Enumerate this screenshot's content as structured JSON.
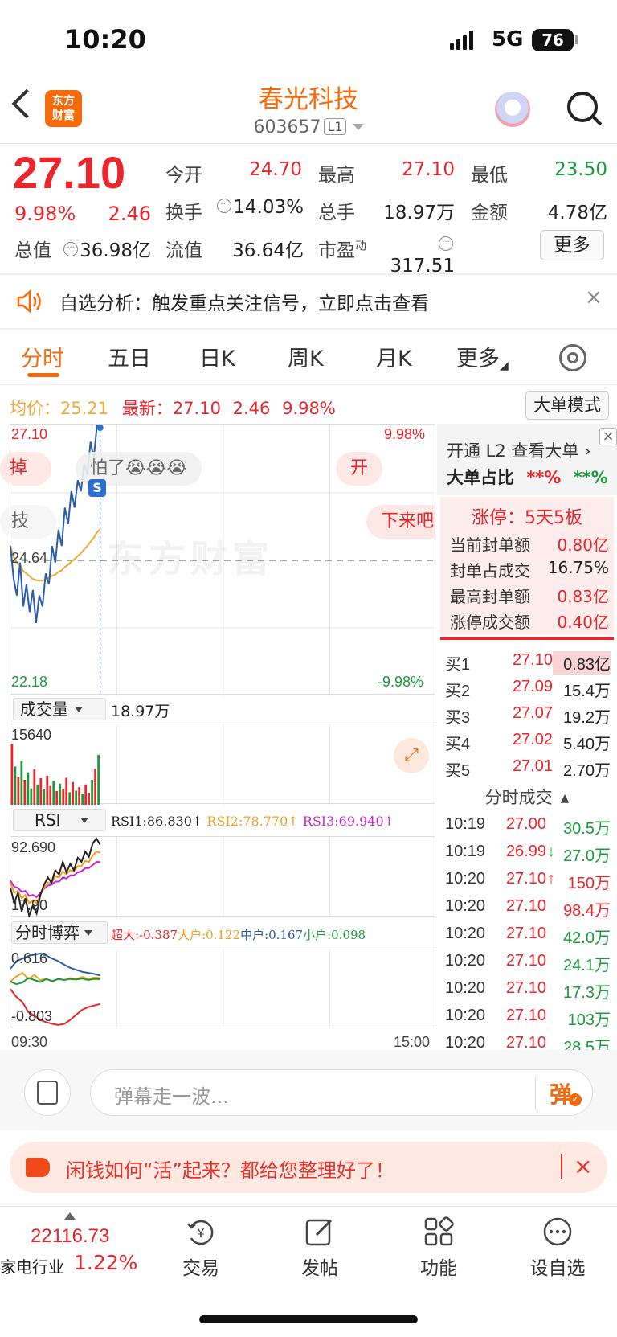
{
  "status": {
    "time": "10:20",
    "network": "5G",
    "battery": "76"
  },
  "header": {
    "logo_text": "东方\n财富",
    "stock_name": "春光科技",
    "stock_code": "603657",
    "level": "L1"
  },
  "quote": {
    "price": "27.10",
    "change_pct": "9.98%",
    "change": "2.46",
    "open_label": "今开",
    "open": "24.70",
    "high_label": "最高",
    "high": "27.10",
    "low_label": "最低",
    "low": "23.50",
    "turnover_label": "换手",
    "turnover": "14.03%",
    "volume_label": "总手",
    "volume": "18.97万",
    "amount_label": "金额",
    "amount": "4.78亿",
    "mktcap_label": "总值",
    "mktcap": "36.98亿",
    "float_label": "流值",
    "float": "36.64亿",
    "pe_label": "市盈",
    "pe_sup": "动",
    "pe": "317.51",
    "more_label": "更多"
  },
  "banner": {
    "text": "自选分析：触发重点关注信号，立即点击查看",
    "close": "×"
  },
  "tabs": [
    "分时",
    "五日",
    "日K",
    "周K",
    "月K",
    "更多"
  ],
  "chart_header": {
    "avg_label": "均价：",
    "avg": "25.21",
    "latest_label": "最新：",
    "latest": "27.10",
    "change": "2.46",
    "pct": "9.98%",
    "big_order_mode": "大单模式"
  },
  "chart_data": [
    {
      "type": "line",
      "name": "分时",
      "ylim": [
        22.18,
        27.1
      ],
      "prev_close": "24.64",
      "y_labels": {
        "top": "27.10",
        "mid": "24.64",
        "bottom": "22.18",
        "top_pct": "9.98%",
        "bottom_pct": "-9.98%"
      },
      "x_labels": [
        "09:30",
        "15:00"
      ],
      "series": [
        {
          "name": "price",
          "color": "#2a5caa",
          "values": [
            24.9,
            24.3,
            24.0,
            24.6,
            23.8,
            24.2,
            23.7,
            24.1,
            23.5,
            24.0,
            23.8,
            24.4,
            24.2,
            24.9,
            24.6,
            25.2,
            24.9,
            25.6,
            25.3,
            25.9,
            25.6,
            26.1,
            25.9,
            26.4,
            26.2,
            26.8,
            26.5,
            27.1,
            27.1
          ]
        },
        {
          "name": "avg",
          "color": "#f2a93b",
          "values": [
            24.9,
            24.7,
            24.6,
            24.55,
            24.45,
            24.4,
            24.35,
            24.3,
            24.28,
            24.27,
            24.27,
            24.3,
            24.32,
            24.36,
            24.38,
            24.43,
            24.46,
            24.52,
            24.56,
            24.62,
            24.66,
            24.72,
            24.77,
            24.84,
            24.9,
            24.98,
            25.05,
            25.15,
            25.21
          ]
        }
      ]
    },
    {
      "type": "bar",
      "name": "成交量",
      "total": "18.97万",
      "max_label": "15640",
      "values": [
        15640,
        9800,
        7200,
        11200,
        6400,
        8300,
        4200,
        9100,
        5200,
        6800,
        3900,
        7400,
        4800,
        6100,
        3500,
        5400,
        4100,
        6900,
        3200,
        5800,
        3600,
        4500,
        2800,
        5200,
        3100,
        6400,
        9200,
        12800
      ],
      "colors": [
        "r",
        "g",
        "r",
        "g",
        "r",
        "g",
        "g",
        "r",
        "g",
        "r",
        "g",
        "r",
        "r",
        "g",
        "r",
        "g",
        "r",
        "r",
        "g",
        "r",
        "g",
        "r",
        "g",
        "r",
        "r",
        "g",
        "r",
        "g"
      ]
    },
    {
      "type": "line",
      "name": "RSI",
      "ylim": [
        17.9,
        92.69
      ],
      "y_labels": {
        "top": "92.690",
        "bottom": "17.90"
      },
      "legend": [
        {
          "label": "RSI1:86.830↑",
          "color": "#222222"
        },
        {
          "label": "RSI2:78.770↑",
          "color": "#f0a020"
        },
        {
          "label": "RSI3:69.940↑",
          "color": "#d020d0"
        }
      ],
      "series": [
        {
          "name": "RSI1",
          "color": "#222222",
          "values": [
            45,
            30,
            40,
            22,
            35,
            18,
            28,
            20,
            38,
            48,
            55,
            50,
            62,
            58,
            70,
            60,
            68,
            62,
            74,
            70,
            80,
            75,
            88,
            92.6,
            86.8
          ]
        },
        {
          "name": "RSI2",
          "color": "#f0a020",
          "values": [
            50,
            40,
            42,
            35,
            38,
            30,
            33,
            30,
            38,
            45,
            50,
            50,
            56,
            55,
            61,
            58,
            62,
            61,
            66,
            66,
            71,
            70,
            76,
            80,
            78.8
          ]
        },
        {
          "name": "RSI3",
          "color": "#d020d0",
          "values": [
            52,
            46,
            45,
            41,
            42,
            37,
            38,
            36,
            40,
            44,
            47,
            48,
            51,
            51,
            55,
            54,
            57,
            57,
            60,
            61,
            64,
            64,
            67,
            70,
            69.9
          ]
        }
      ]
    },
    {
      "type": "line",
      "name": "分时博弈",
      "ylim": [
        -0.803,
        0.616
      ],
      "y_labels": {
        "top": "0.616",
        "bottom": "-0.803"
      },
      "legend": [
        {
          "label": "超大:-0.387",
          "color": "#e8262b"
        },
        {
          "label": "大户:0.122",
          "color": "#f0a020"
        },
        {
          "label": "中户:0.167",
          "color": "#2a5caa"
        },
        {
          "label": "小户:0.098",
          "color": "#1a9c3a"
        }
      ],
      "series": [
        {
          "name": "超大",
          "color": "#e8262b",
          "values": [
            -0.1,
            -0.25,
            -0.35,
            -0.55,
            -0.62,
            -0.7,
            -0.75,
            -0.78,
            -0.8,
            -0.78,
            -0.7,
            -0.6,
            -0.5,
            -0.45,
            -0.42,
            -0.39
          ]
        },
        {
          "name": "大户",
          "color": "#f0a020",
          "values": [
            0.05,
            0.15,
            0.22,
            0.1,
            0.18,
            0.08,
            0.1,
            0.05,
            0.1,
            0.08,
            0.12,
            0.1,
            0.14,
            0.1,
            0.13,
            0.12
          ]
        },
        {
          "name": "中户",
          "color": "#2a5caa",
          "values": [
            0.3,
            0.45,
            0.5,
            0.55,
            0.58,
            0.6,
            0.56,
            0.5,
            0.45,
            0.38,
            0.32,
            0.28,
            0.24,
            0.22,
            0.2,
            0.17
          ]
        },
        {
          "name": "小户",
          "color": "#1a9c3a",
          "values": [
            0.05,
            0.0,
            0.03,
            0.12,
            0.08,
            0.04,
            0.1,
            0.06,
            0.1,
            0.08,
            0.1,
            0.09,
            0.11,
            0.08,
            0.1,
            0.098
          ]
        }
      ]
    }
  ],
  "sub_selectors": {
    "volume": "成交量",
    "rsi": "RSI",
    "game": "分时博弈"
  },
  "danmaku": [
    "掉",
    "怕了😭😭😭",
    "开",
    "技",
    "下来吧"
  ],
  "watermark": "东方财富",
  "right_panel": {
    "open_l2": "开通 L2 查看大单 ›",
    "ratio_label": "大单占比",
    "ratio_red": "**%",
    "ratio_green": "**%",
    "limit_title": "涨停：5天5板",
    "limit_rows": [
      {
        "label": "当前封单额",
        "value": "0.80亿"
      },
      {
        "label": "封单占成交",
        "value": "16.75%"
      },
      {
        "label": "最高封单额",
        "value": "0.83亿"
      },
      {
        "label": "涨停成交额",
        "value": "0.40亿"
      }
    ],
    "order_book": [
      {
        "label": "买1",
        "price": "27.10",
        "vol": "0.83亿"
      },
      {
        "label": "买2",
        "price": "27.09",
        "vol": "15.4万"
      },
      {
        "label": "买3",
        "price": "27.07",
        "vol": "19.2万"
      },
      {
        "label": "买4",
        "price": "27.02",
        "vol": "5.40万"
      },
      {
        "label": "买5",
        "price": "27.01",
        "vol": "2.70万"
      }
    ],
    "ticks_title": "分时成交",
    "ticks": [
      {
        "time": "10:19",
        "price": "27.00",
        "arrow": "",
        "vol": "30.5万",
        "color": "green"
      },
      {
        "time": "10:19",
        "price": "26.99",
        "arrow": "↓",
        "vol": "27.0万",
        "color": "green"
      },
      {
        "time": "10:20",
        "price": "27.10",
        "arrow": "↑",
        "vol": "150万",
        "color": "red"
      },
      {
        "time": "10:20",
        "price": "27.10",
        "arrow": "",
        "vol": "98.4万",
        "color": "red"
      },
      {
        "time": "10:20",
        "price": "27.10",
        "arrow": "",
        "vol": "42.0万",
        "color": "green"
      },
      {
        "time": "10:20",
        "price": "27.10",
        "arrow": "",
        "vol": "24.1万",
        "color": "green"
      },
      {
        "time": "10:20",
        "price": "27.10",
        "arrow": "",
        "vol": "17.3万",
        "color": "green"
      },
      {
        "time": "10:20",
        "price": "27.10",
        "arrow": "",
        "vol": "103万",
        "color": "green"
      },
      {
        "time": "10:20",
        "price": "27.10",
        "arrow": "",
        "vol": "28.5万",
        "color": "green"
      }
    ]
  },
  "comment": {
    "placeholder": "弹幕走一波...",
    "danmaku_btn": "弹"
  },
  "promo": {
    "text": "闲钱如何“活”起来？都给您整理好了！",
    "close": "×"
  },
  "bottom_nav": {
    "index_value": "22116.73",
    "index_name": "家电行业",
    "index_pct": "1.22%",
    "items": [
      "交易",
      "发帖",
      "功能",
      "设自选"
    ]
  }
}
